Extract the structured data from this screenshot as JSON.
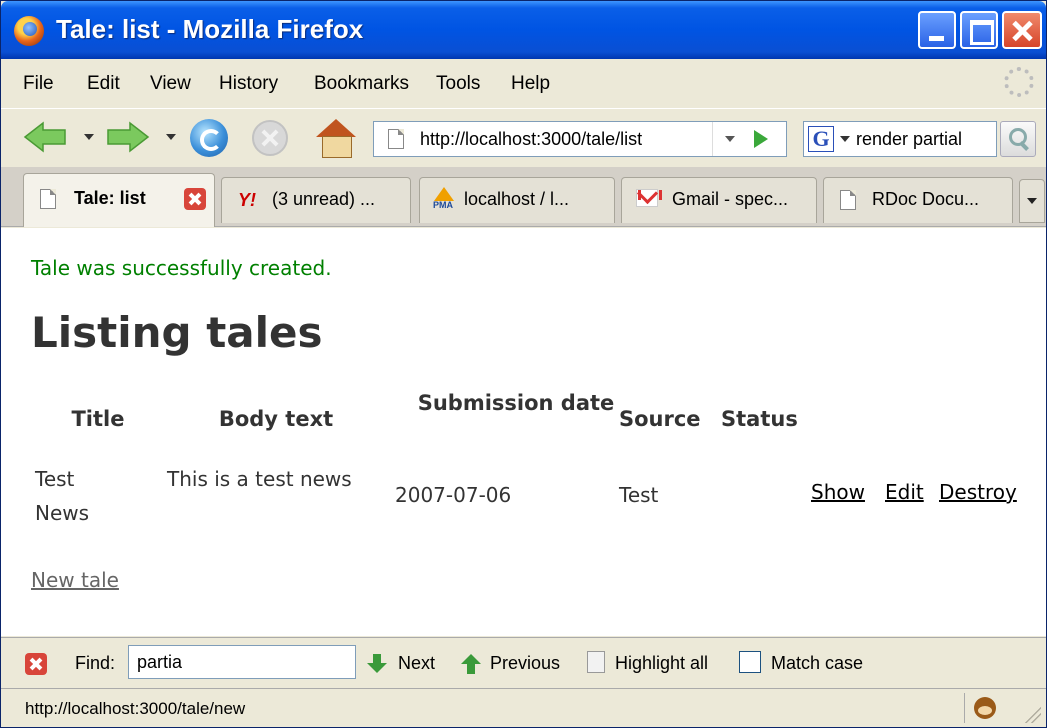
{
  "window": {
    "title": "Tale: list - Mozilla Firefox"
  },
  "menu": {
    "items": [
      {
        "label": "File"
      },
      {
        "label": "Edit"
      },
      {
        "label": "View"
      },
      {
        "label": "History"
      },
      {
        "label": "Bookmarks"
      },
      {
        "label": "Tools"
      },
      {
        "label": "Help"
      }
    ]
  },
  "navigation": {
    "url": "http://localhost:3000/tale/list",
    "search_query": "render partial",
    "search_engine_icon": "G"
  },
  "tabs": [
    {
      "label": "Tale: list",
      "icon": "page-icon",
      "active": true
    },
    {
      "label": "(3 unread) ...",
      "icon": "yahoo-icon"
    },
    {
      "label": "localhost / l...",
      "icon": "phpmyadmin-icon"
    },
    {
      "label": "Gmail - spec...",
      "icon": "gmail-icon"
    },
    {
      "label": "RDoc Docu...",
      "icon": "page-icon"
    }
  ],
  "yahoo_glyph": "Y!",
  "page": {
    "notice": "Tale was successfully created.",
    "heading": "Listing tales",
    "table": {
      "headers": [
        "Title",
        "Body text",
        "Submission date",
        "Source",
        "Status"
      ],
      "rows": [
        {
          "title": "Test News",
          "body_text": "This is a test news",
          "submission_date": "2007-07-06",
          "source": "Test",
          "status": "",
          "actions": [
            "Show",
            "Edit",
            "Destroy"
          ]
        }
      ]
    },
    "new_link": "New tale",
    "colors": {
      "notice": "#008000",
      "text": "#333333",
      "link_visited": "#666666"
    }
  },
  "findbar": {
    "label": "Find:",
    "value": "partia",
    "next": "Next",
    "previous": "Previous",
    "highlight_all": "Highlight all",
    "match_case": "Match case",
    "match_case_checked": false
  },
  "status": {
    "text": "http://localhost:3000/tale/new"
  }
}
